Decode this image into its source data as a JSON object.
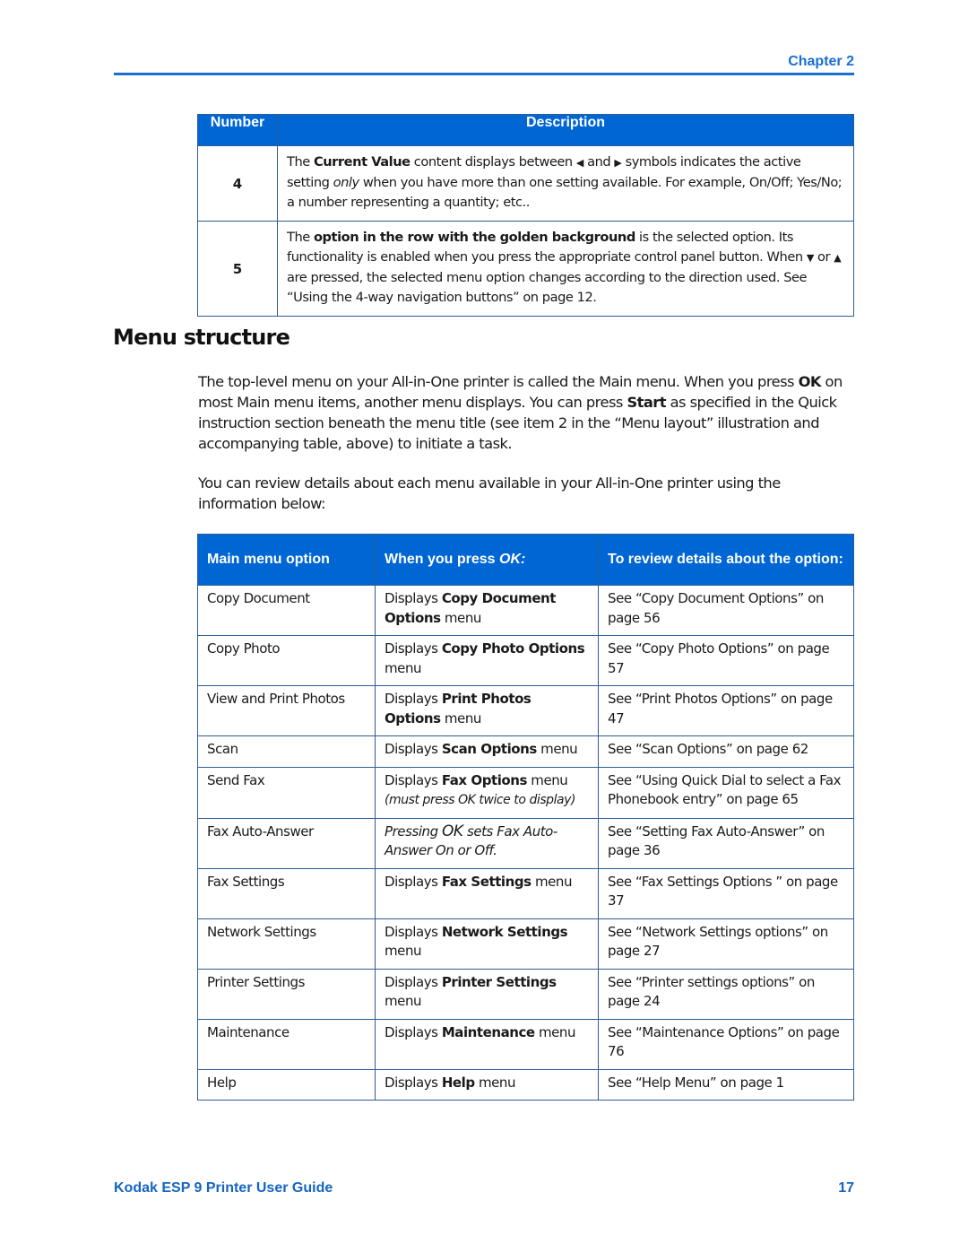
{
  "header": {
    "chapter": "Chapter 2",
    "accent_color": "#1a6fd1"
  },
  "desc_table": {
    "headers": {
      "number": "Number",
      "description": "Description"
    },
    "rows": [
      {
        "number": "4",
        "parts": {
          "a": "The ",
          "b": "Current Value",
          "c": " content displays between ",
          "left_icon": "◀",
          "d": " and ",
          "right_icon": "▶",
          "e": " symbols indicates the active setting ",
          "f": "only",
          "g": " when you have more than one setting available. For example, On/Off; Yes/No; a number representing a quantity; etc.."
        }
      },
      {
        "number": "5",
        "parts": {
          "a": "The ",
          "b": "option in the row with the golden background",
          "c": " is the selected option. Its functionality is enabled when you press the appropriate control panel button. When ",
          "down_icon": "▼",
          "d": " or ",
          "up_icon": "▲",
          "e": " are pressed, the selected menu option changes according to the direction used. See “Using the 4-way navigation buttons” on page 12."
        }
      }
    ]
  },
  "section": {
    "title": "Menu structure",
    "para1": {
      "a": "The top-level menu on your All-in-One printer is called the Main menu. When you press ",
      "b": "OK",
      "c": " on most Main menu items, another menu displays. You can press ",
      "d": "Start",
      "e": " as specified in the Quick instruction section beneath the menu title (see item 2 in the “Menu layout” illustration and accompanying table, above) to initiate a task."
    },
    "para2": "You can review details about each menu available in your All-in-One printer using the information below:"
  },
  "menu_table": {
    "headers": {
      "option": "Main menu option",
      "press_prefix": "When you press ",
      "press_ok": "OK:",
      "review": "To review details about the option:"
    },
    "rows": [
      {
        "option": "Copy Document",
        "pre": "Displays ",
        "bold": "Copy Document Options",
        "post": " menu",
        "review": "See “Copy Document Options” on page 56"
      },
      {
        "option": "Copy Photo",
        "pre": "Displays ",
        "bold": "Copy Photo Options",
        "post": " menu",
        "review": "See “Copy Photo Options” on page 57"
      },
      {
        "option": "View and Print Photos",
        "pre": "Displays ",
        "bold": "Print Photos Options",
        "post": " menu",
        "review": "See “Print Photos Options” on page 47"
      },
      {
        "option": "Scan",
        "pre": "Displays ",
        "bold": "Scan Options",
        "post": " menu",
        "review": "See “Scan Options” on page 62"
      },
      {
        "option": "Send Fax",
        "pre": "Displays ",
        "bold": "Fax Options",
        "post": " menu",
        "note": "(must press OK twice to display)",
        "review": "See “Using Quick Dial to select a Fax Phonebook entry” on page 65"
      },
      {
        "option": "Fax Auto-Answer",
        "italic_a": "Pressing ",
        "italic_ok": "OK",
        "italic_b": " sets Fax Auto-Answer On or Off.",
        "review": "See “Setting Fax Auto-Answer” on page 36"
      },
      {
        "option": "Fax Settings",
        "pre": "Displays ",
        "bold": "Fax Settings",
        "post": " menu",
        "review": "See “Fax Settings Options ” on page 37"
      },
      {
        "option": "Network Settings",
        "pre": "Displays ",
        "bold": "Network Settings",
        "post": " menu",
        "review": "See “Network Settings options” on page 27"
      },
      {
        "option": "Printer Settings",
        "pre": "Displays ",
        "bold": "Printer Settings",
        "post": " menu",
        "review": "See “Printer settings options” on page 24"
      },
      {
        "option": "Maintenance",
        "pre": "Displays ",
        "bold": "Maintenance",
        "post": " menu",
        "review": "See “Maintenance Options” on page 76"
      },
      {
        "option": "Help",
        "pre": "Displays ",
        "bold": "Help",
        "post": " menu",
        "review": "See “Help Menu” on page 1"
      }
    ]
  },
  "footer": {
    "title": "Kodak ESP 9 Printer User Guide",
    "page": "17"
  }
}
